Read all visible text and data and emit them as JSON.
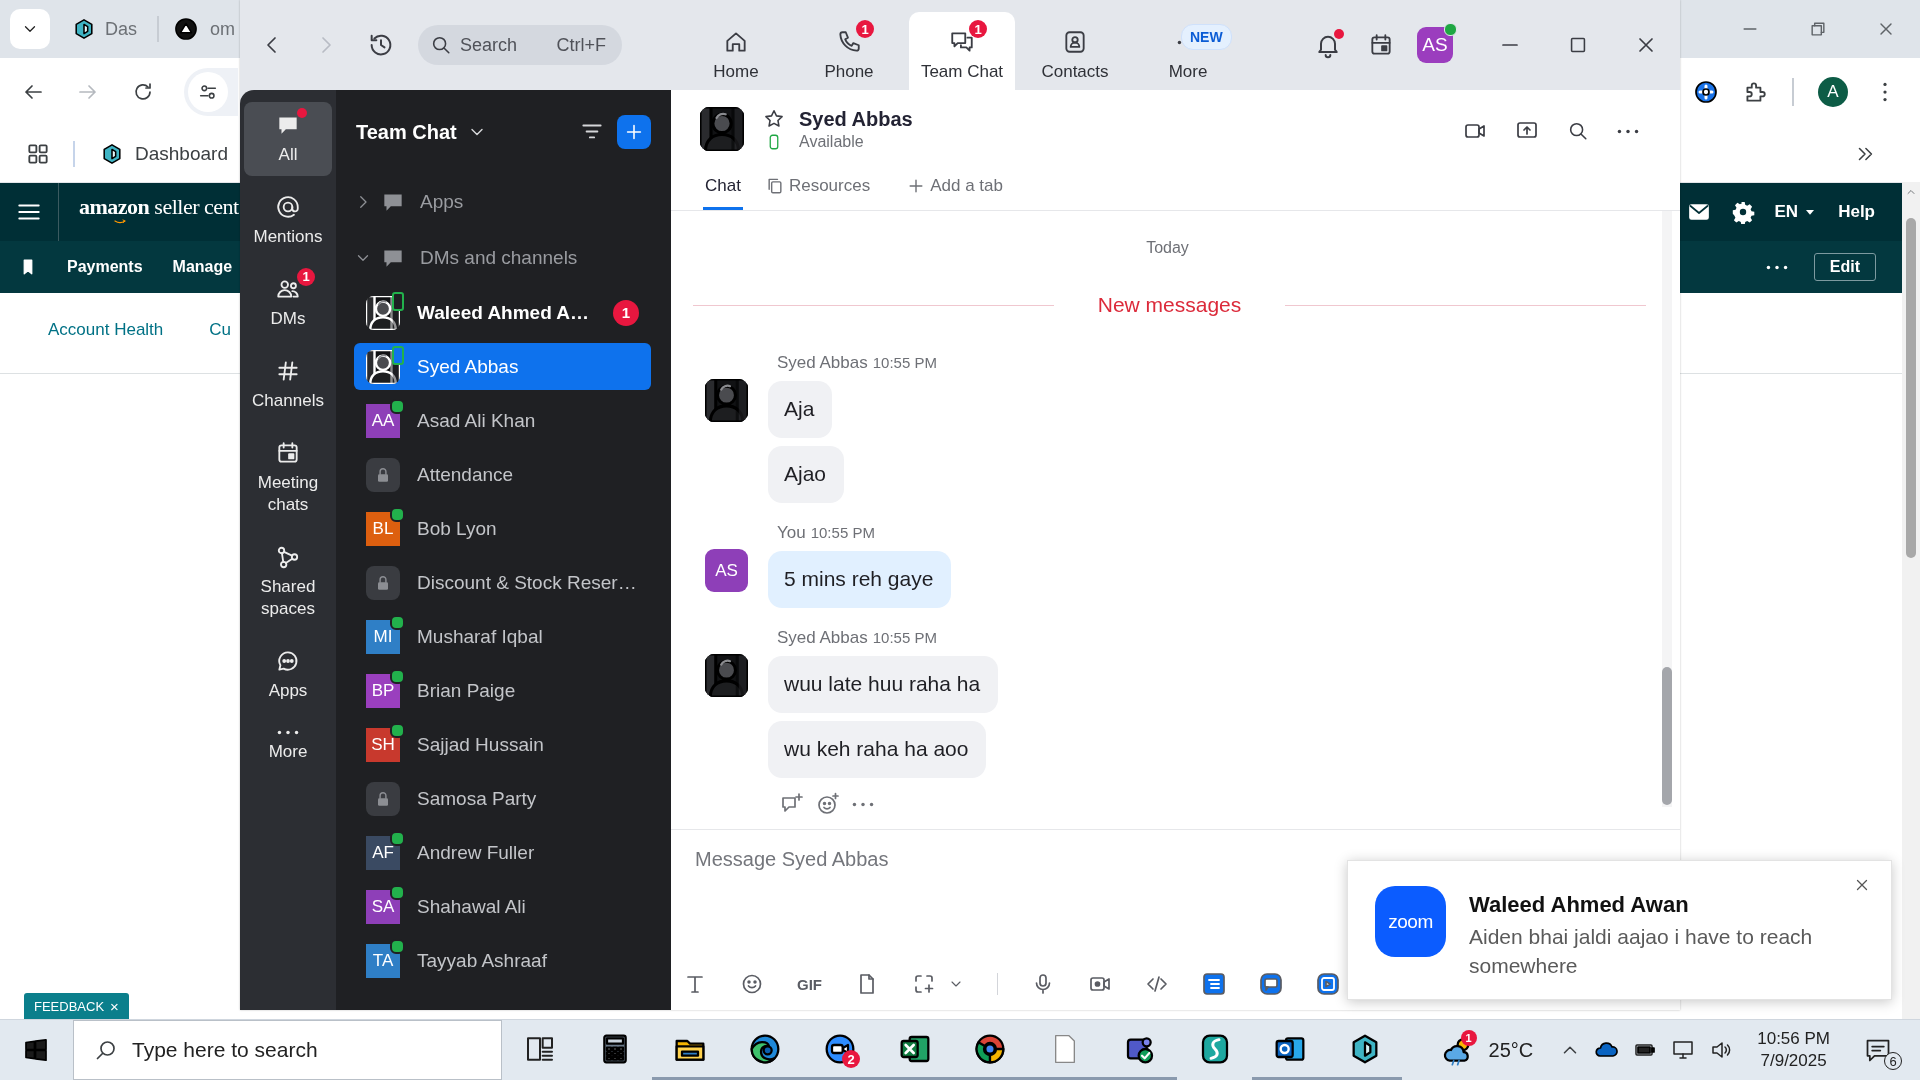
{
  "browser": {
    "tabs": [
      {
        "title": "Das"
      },
      {
        "title": "om"
      }
    ],
    "bookmarks": [
      {
        "label": "Dashboard"
      }
    ],
    "profile_initial": "A",
    "site": {
      "logo": "**amazon** seller cent",
      "nav_links": [
        "Payments",
        "Manage"
      ],
      "language": "EN",
      "help": "Help",
      "edit_button": "Edit",
      "page_links": [
        "Account Health",
        "Cu"
      ]
    },
    "feedback": {
      "label": "FEEDBACK",
      "close": "×"
    }
  },
  "zoom_window": {
    "search": {
      "placeholder": "Search",
      "shortcut": "Ctrl+F"
    },
    "nav_tabs": [
      {
        "kind": "home",
        "label": "Home",
        "selected": false
      },
      {
        "kind": "phone",
        "label": "Phone",
        "badge": "1",
        "selected": false
      },
      {
        "kind": "chat",
        "label": "Team Chat",
        "badge": "1",
        "selected": true
      },
      {
        "kind": "contacts",
        "label": "Contacts",
        "selected": false
      },
      {
        "kind": "more",
        "label": "More",
        "tag": "NEW",
        "selected": false
      }
    ],
    "notifications_unread": true,
    "user": {
      "initials": "AS",
      "online": true
    },
    "rail": [
      {
        "kind": "all",
        "label": "All",
        "selected": true,
        "unread": true
      },
      {
        "kind": "mentions",
        "label": "Mentions",
        "selected": false,
        "unread": false
      },
      {
        "kind": "dms",
        "label": "DMs",
        "badge": "1",
        "selected": false,
        "unread": false
      },
      {
        "kind": "channels",
        "label": "Channels",
        "selected": false,
        "unread": false
      },
      {
        "kind": "meetings",
        "label": "Meeting chats",
        "selected": false,
        "unread": false
      },
      {
        "kind": "shared",
        "label": "Shared spaces",
        "selected": false,
        "unread": false
      },
      {
        "kind": "apps",
        "label": "Apps",
        "selected": false,
        "unread": false
      },
      {
        "kind": "more",
        "label": "More",
        "selected": false,
        "unread": false
      }
    ],
    "chat_list": {
      "title": "Team Chat",
      "sections": [
        {
          "label": "Apps",
          "expanded": false
        },
        {
          "label": "DMs and channels",
          "expanded": true,
          "items": [
            {
              "name": "Waleed Ahmed A…",
              "mobile": true,
              "online": false,
              "unread": "1",
              "selected": false
            },
            {
              "name": "Syed Abbas",
              "mobile": true,
              "online": false,
              "selected": true
            },
            {
              "name": "Asad Ali Khan",
              "kind": "initials",
              "initials": "AA",
              "color": "#8e3fb8",
              "mobile": false,
              "online": true,
              "selected": false
            },
            {
              "name": "Attendance",
              "kind": "channel",
              "mobile": false,
              "online": false,
              "selected": false
            },
            {
              "name": "Bob Lyon",
              "kind": "initials",
              "initials": "BL",
              "color": "#dd5f0f",
              "mobile": false,
              "online": true,
              "selected": false
            },
            {
              "name": "Discount & Stock Reser…",
              "kind": "channel",
              "mobile": false,
              "online": false,
              "selected": false
            },
            {
              "name": "Musharaf Iqbal",
              "kind": "initials",
              "initials": "MI",
              "color": "#2f7fc6",
              "mobile": false,
              "online": true,
              "selected": false
            },
            {
              "name": "Brian Paige",
              "kind": "initials",
              "initials": "BP",
              "color": "#9a3fbe",
              "mobile": false,
              "online": true,
              "selected": false
            },
            {
              "name": "Sajjad Hussain",
              "kind": "initials",
              "initials": "SH",
              "color": "#c8392d",
              "mobile": false,
              "online": true,
              "selected": false
            },
            {
              "name": "Samosa Party",
              "kind": "channel",
              "mobile": false,
              "online": false,
              "selected": false
            },
            {
              "name": "Andrew Fuller",
              "kind": "initials",
              "initials": "AF",
              "color": "#3a4a62",
              "mobile": false,
              "online": true,
              "selected": false
            },
            {
              "name": "Shahawal Ali",
              "kind": "initials",
              "initials": "SA",
              "color": "#8e3fb8",
              "mobile": false,
              "online": true,
              "selected": false
            },
            {
              "name": "Tayyab Ashraaf",
              "kind": "initials",
              "initials": "TA",
              "color": "#2f7fc6",
              "mobile": false,
              "online": true,
              "selected": false
            }
          ]
        }
      ]
    },
    "conversation": {
      "name": "Syed Abbas",
      "starred": false,
      "status": "Available",
      "tabs": [
        {
          "kind": "chat",
          "label": "Chat",
          "selected": true
        },
        {
          "kind": "resources",
          "label": "Resources",
          "selected": false
        }
      ],
      "add_tab": "Add a tab",
      "day": "Today",
      "new_marker": "New messages",
      "messages": [
        {
          "sender": "Syed Abbas",
          "time": "10:55 PM",
          "mine": false,
          "texts": [
            "Aja",
            "Ajao"
          ]
        },
        {
          "sender": "You",
          "time": "10:55 PM",
          "mine": true,
          "kind": "initials",
          "initials": "AS",
          "color": "#8e3fb8",
          "texts": [
            "5 mins reh gaye"
          ]
        },
        {
          "sender": "Syed Abbas",
          "time": "10:55 PM",
          "mine": false,
          "texts": [
            "wuu late huu raha ha",
            "wu keh raha ha aoo"
          ]
        }
      ],
      "composer": {
        "placeholder": "Message Syed Abbas",
        "gif": "GIF"
      }
    }
  },
  "toast": {
    "logo": "zoom",
    "title": "Waleed Ahmed Awan",
    "body": "Aiden bhai jaldi aajao i have to reach somewhere"
  },
  "taskbar": {
    "search_placeholder": "Type here to search",
    "apps": [
      {
        "kind": "taskview",
        "running": false
      },
      {
        "kind": "calculator",
        "running": false
      },
      {
        "kind": "explorer",
        "running": true
      },
      {
        "kind": "edge",
        "running": true
      },
      {
        "kind": "zoom",
        "running": true,
        "badge": "2"
      },
      {
        "kind": "excel",
        "running": true
      },
      {
        "kind": "chrome",
        "running": true
      },
      {
        "kind": "file",
        "running": true
      },
      {
        "kind": "teams",
        "running": true
      },
      {
        "kind": "surfshark",
        "running": false
      },
      {
        "kind": "outlook",
        "running": true
      },
      {
        "kind": "hexagon",
        "running": true
      }
    ],
    "weather": {
      "badge": "1",
      "temperature": "25°C"
    },
    "time": "10:56 PM",
    "date": "7/9/2025",
    "notification_count": "6"
  }
}
